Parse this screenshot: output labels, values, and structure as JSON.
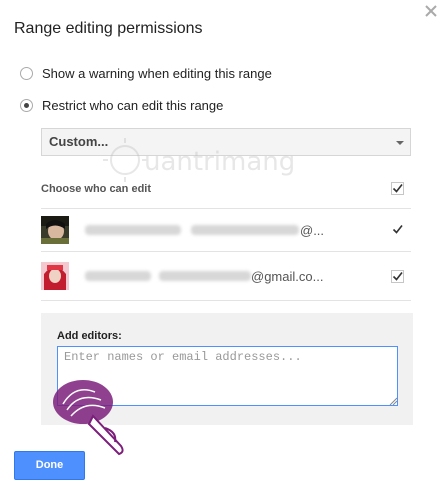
{
  "dialog": {
    "title": "Range editing permissions"
  },
  "options": [
    {
      "label": "Show a warning when editing this range",
      "selected": false
    },
    {
      "label": "Restrict who can edit this range",
      "selected": true
    }
  ],
  "select": {
    "value": "Custom..."
  },
  "choose_label": "Choose who can edit",
  "users": [
    {
      "email_tail": "@...",
      "checked": true
    },
    {
      "email_tail": "@gmail.co...",
      "checked": true
    }
  ],
  "editors": {
    "label": "Add editors:",
    "placeholder": "Enter names or email addresses..."
  },
  "done_label": "Done",
  "watermark": {
    "text": "uantrimang"
  },
  "colors": {
    "accent": "#4d90fe",
    "hand": "#7b1f7a"
  }
}
